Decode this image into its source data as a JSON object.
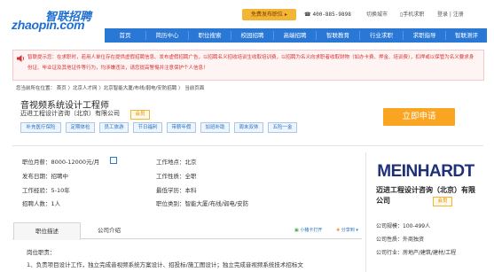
{
  "header": {
    "logo_cn": "智联招聘",
    "logo_en": "zhaopin.com",
    "free_post": "免费发布职位 ▸",
    "hotline_label": "☎",
    "hotline": "400-885-9898",
    "switch_city": "切换城市",
    "mobile": "▯手机求职",
    "login": "登录 | 注册"
  },
  "nav": [
    "首页",
    "简历中心",
    "职位搜索",
    "校园招聘",
    "高端招聘",
    "智联教育",
    "行业求职",
    "求职指导",
    "智联测评"
  ],
  "notice": "智联提示您：在求职时，若用人单位存在提供虚假招聘信息、发布虚假招聘广告，以招聘名义招收培训生收取培训费，以招聘为名义向求职者收取财物（如办卡费、押金、培训费），扣押或以保管为名义要求身份证、毕业证及其他证件等行为，均涉嫌违法，请您提高警惕并注意保护个人信息！",
  "breadcrumb": "您当前所在位置： 首页 〉北京人才网 〉北京智能大厦/布线/弱电/安防招聘 〉 当前页面",
  "job": {
    "title": "音视频系统设计工程师",
    "company": "迈进工程设计咨询（北京）有限公司",
    "member": "会员",
    "tags": [
      "补充医疗保险",
      "定期体检",
      "员工旅游",
      "节日福利",
      "带薪年假",
      "加班补助",
      "周末双休",
      "五险一金"
    ],
    "apply": "立即申请"
  },
  "details": {
    "salary_label": "职位月薪：",
    "salary": "8000-12000元/月",
    "location_label": "工作地点：",
    "location": "北京",
    "date_label": "发布日期：",
    "date": "招聘中",
    "nature_label": "工作性质：",
    "nature": "全职",
    "experience_label": "工作经验：",
    "experience": "5-10年",
    "education_label": "最低学历：",
    "education": "本科",
    "count_label": "招聘人数：",
    "count": "1人",
    "category_label": "职位类别：",
    "category": "智能大厦/布线/弱电/安防"
  },
  "company_card": {
    "logo_text": "MEINHARDT",
    "name": "迈进工程设计咨询（北京）有限公司",
    "member": "会员",
    "size_label": "公司规模：",
    "size": "100-499人",
    "type_label": "公司性质：",
    "type": "外商独资",
    "industry_label": "公司行业：",
    "industry": "房地产/建筑/建材/工程"
  },
  "tabs": {
    "desc": "职位描述",
    "company": "公司介绍",
    "share": "小猪卡打开",
    "collect": "分享到 ▾"
  },
  "description": {
    "head": "岗位职责：",
    "line1": "1、负责项目设计工作，独立完成音视频系统方案设计、招投标/施工图设计；独立完成音视频系统技术招标文"
  },
  "colors": {
    "nav_bg": "#2a78d5",
    "apply_bg": "#f9a521",
    "notice_text": "#d83030",
    "free_post_bg": "#f3b535"
  }
}
